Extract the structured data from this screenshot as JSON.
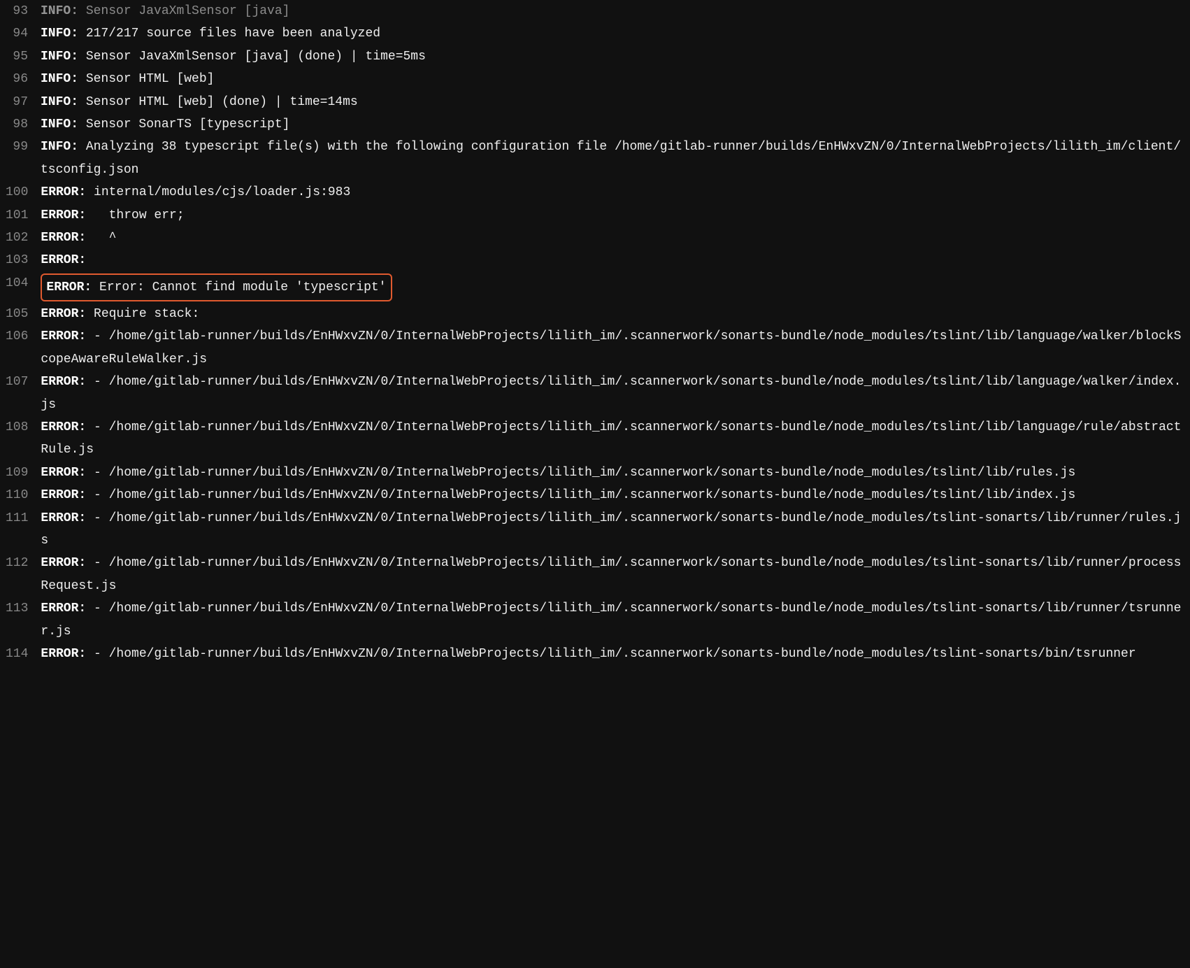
{
  "lines": [
    {
      "num": "93",
      "prefix": "INFO:",
      "text": " Sensor JavaXmlSensor [java]",
      "partial": true,
      "highlighted": false
    },
    {
      "num": "94",
      "prefix": "INFO:",
      "text": " 217/217 source files have been analyzed",
      "partial": false,
      "highlighted": false
    },
    {
      "num": "95",
      "prefix": "INFO:",
      "text": " Sensor JavaXmlSensor [java] (done) | time=5ms",
      "partial": false,
      "highlighted": false
    },
    {
      "num": "96",
      "prefix": "INFO:",
      "text": " Sensor HTML [web]",
      "partial": false,
      "highlighted": false
    },
    {
      "num": "97",
      "prefix": "INFO:",
      "text": " Sensor HTML [web] (done) | time=14ms",
      "partial": false,
      "highlighted": false
    },
    {
      "num": "98",
      "prefix": "INFO:",
      "text": " Sensor SonarTS [typescript]",
      "partial": false,
      "highlighted": false
    },
    {
      "num": "99",
      "prefix": "INFO:",
      "text": " Analyzing 38 typescript file(s) with the following configuration file /home/gitlab-runner/builds/EnHWxvZN/0/InternalWebProjects/lilith_im/client/tsconfig.json",
      "partial": false,
      "highlighted": false
    },
    {
      "num": "100",
      "prefix": "ERROR:",
      "text": " internal/modules/cjs/loader.js:983",
      "partial": false,
      "highlighted": false
    },
    {
      "num": "101",
      "prefix": "ERROR:",
      "text": "   throw err;",
      "partial": false,
      "highlighted": false
    },
    {
      "num": "102",
      "prefix": "ERROR:",
      "text": "   ^",
      "partial": false,
      "highlighted": false
    },
    {
      "num": "103",
      "prefix": "ERROR:",
      "text": "",
      "partial": false,
      "highlighted": false
    },
    {
      "num": "104",
      "prefix": "ERROR:",
      "text": " Error: Cannot find module 'typescript'",
      "partial": false,
      "highlighted": true
    },
    {
      "num": "105",
      "prefix": "ERROR:",
      "text": " Require stack:",
      "partial": false,
      "highlighted": false
    },
    {
      "num": "106",
      "prefix": "ERROR:",
      "text": " - /home/gitlab-runner/builds/EnHWxvZN/0/InternalWebProjects/lilith_im/.scannerwork/sonarts-bundle/node_modules/tslint/lib/language/walker/blockScopeAwareRuleWalker.js",
      "partial": false,
      "highlighted": false
    },
    {
      "num": "107",
      "prefix": "ERROR:",
      "text": " - /home/gitlab-runner/builds/EnHWxvZN/0/InternalWebProjects/lilith_im/.scannerwork/sonarts-bundle/node_modules/tslint/lib/language/walker/index.js",
      "partial": false,
      "highlighted": false
    },
    {
      "num": "108",
      "prefix": "ERROR:",
      "text": " - /home/gitlab-runner/builds/EnHWxvZN/0/InternalWebProjects/lilith_im/.scannerwork/sonarts-bundle/node_modules/tslint/lib/language/rule/abstractRule.js",
      "partial": false,
      "highlighted": false
    },
    {
      "num": "109",
      "prefix": "ERROR:",
      "text": " - /home/gitlab-runner/builds/EnHWxvZN/0/InternalWebProjects/lilith_im/.scannerwork/sonarts-bundle/node_modules/tslint/lib/rules.js",
      "partial": false,
      "highlighted": false
    },
    {
      "num": "110",
      "prefix": "ERROR:",
      "text": " - /home/gitlab-runner/builds/EnHWxvZN/0/InternalWebProjects/lilith_im/.scannerwork/sonarts-bundle/node_modules/tslint/lib/index.js",
      "partial": false,
      "highlighted": false
    },
    {
      "num": "111",
      "prefix": "ERROR:",
      "text": " - /home/gitlab-runner/builds/EnHWxvZN/0/InternalWebProjects/lilith_im/.scannerwork/sonarts-bundle/node_modules/tslint-sonarts/lib/runner/rules.js",
      "partial": false,
      "highlighted": false
    },
    {
      "num": "112",
      "prefix": "ERROR:",
      "text": " - /home/gitlab-runner/builds/EnHWxvZN/0/InternalWebProjects/lilith_im/.scannerwork/sonarts-bundle/node_modules/tslint-sonarts/lib/runner/processRequest.js",
      "partial": false,
      "highlighted": false
    },
    {
      "num": "113",
      "prefix": "ERROR:",
      "text": " - /home/gitlab-runner/builds/EnHWxvZN/0/InternalWebProjects/lilith_im/.scannerwork/sonarts-bundle/node_modules/tslint-sonarts/lib/runner/tsrunner.js",
      "partial": false,
      "highlighted": false
    },
    {
      "num": "114",
      "prefix": "ERROR:",
      "text": " - /home/gitlab-runner/builds/EnHWxvZN/0/InternalWebProjects/lilith_im/.scannerwork/sonarts-bundle/node_modules/tslint-sonarts/bin/tsrunner",
      "partial": false,
      "highlighted": false
    }
  ]
}
